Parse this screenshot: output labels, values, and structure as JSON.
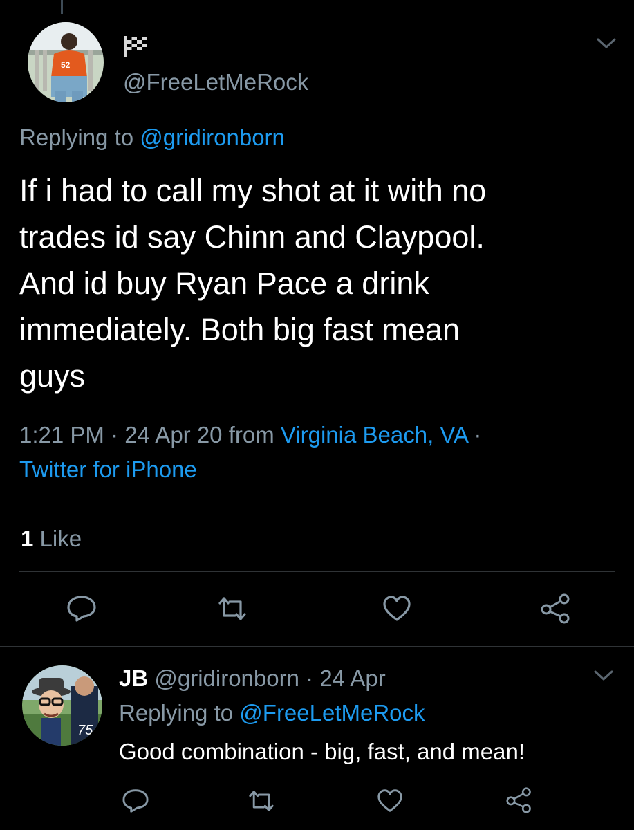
{
  "main_tweet": {
    "handle": "@FreeLetMeRock",
    "replying_prefix": "Replying to",
    "replying_to": "@gridironborn",
    "text": "If i had to call my shot at it with no\ntrades id say Chinn and Claypool.\nAnd id buy Ryan Pace a drink\nimmediately. Both big fast mean\nguys",
    "time": "1:21 PM",
    "date": "24 Apr 20",
    "from_label": "from",
    "location": "Virginia Beach, VA",
    "client": "Twitter for iPhone",
    "like_count": "1",
    "like_label": "Like"
  },
  "reply_tweet": {
    "name": "JB",
    "handle": "@gridironborn",
    "date": "24 Apr",
    "replying_prefix": "Replying to",
    "replying_to": "@FreeLetMeRock",
    "text": "Good combination - big, fast, and mean!",
    "avatar_number": "75"
  },
  "icons": {
    "reply": "reply-icon",
    "retweet": "retweet-icon",
    "like": "heart-icon",
    "share": "share-icon",
    "more": "chevron-down-icon",
    "badge": "checkered-flag-icon"
  },
  "colors": {
    "background": "#000000",
    "text": "#ffffff",
    "muted": "#8899a6",
    "link": "#1d9bf0",
    "divider": "#2f3336"
  }
}
